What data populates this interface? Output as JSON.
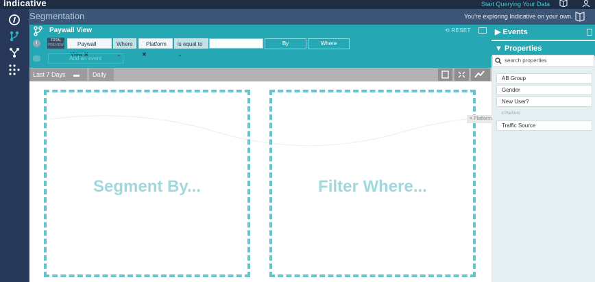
{
  "topbar": {
    "brand": "indicative",
    "link": "Start Querying Your Data",
    "icons": [
      "book-icon",
      "user-icon"
    ]
  },
  "leftnav": {
    "icons": [
      "compass-icon",
      "segmentation-icon",
      "funnel-icon",
      "dots-grid-icon"
    ]
  },
  "header": {
    "title": "Segmentation",
    "note": "You're exploring Indicative on your own."
  },
  "query": {
    "title": "Paywall View",
    "reset": "RESET",
    "badge_top": "TOTAL",
    "badge_bottom": "PREVIEW",
    "event_chip": "Paywall View",
    "where_chip": "Where",
    "property_chip": "Platform",
    "operator_chip": "is equal to",
    "value": "",
    "by_button": "By",
    "where_button": "Where",
    "add_event": "Add an event"
  },
  "toolbar": {
    "date_range": "Last 7 Days",
    "granularity": "Daily"
  },
  "canvas": {
    "segment_label": "Segment By...",
    "filter_label": "Filter Where..."
  },
  "drag_ghost": "Platform",
  "rpanel": {
    "events_label": "Events",
    "properties_label": "Properties",
    "search_placeholder": "search properties",
    "ghost_label": "Platform",
    "properties": [
      "AB Group",
      "Gender",
      "New User?",
      "Traffic Source"
    ]
  },
  "colors": {
    "accent": "#25a8b3",
    "nav": "#27385a",
    "dashed": "#66c4cc"
  }
}
